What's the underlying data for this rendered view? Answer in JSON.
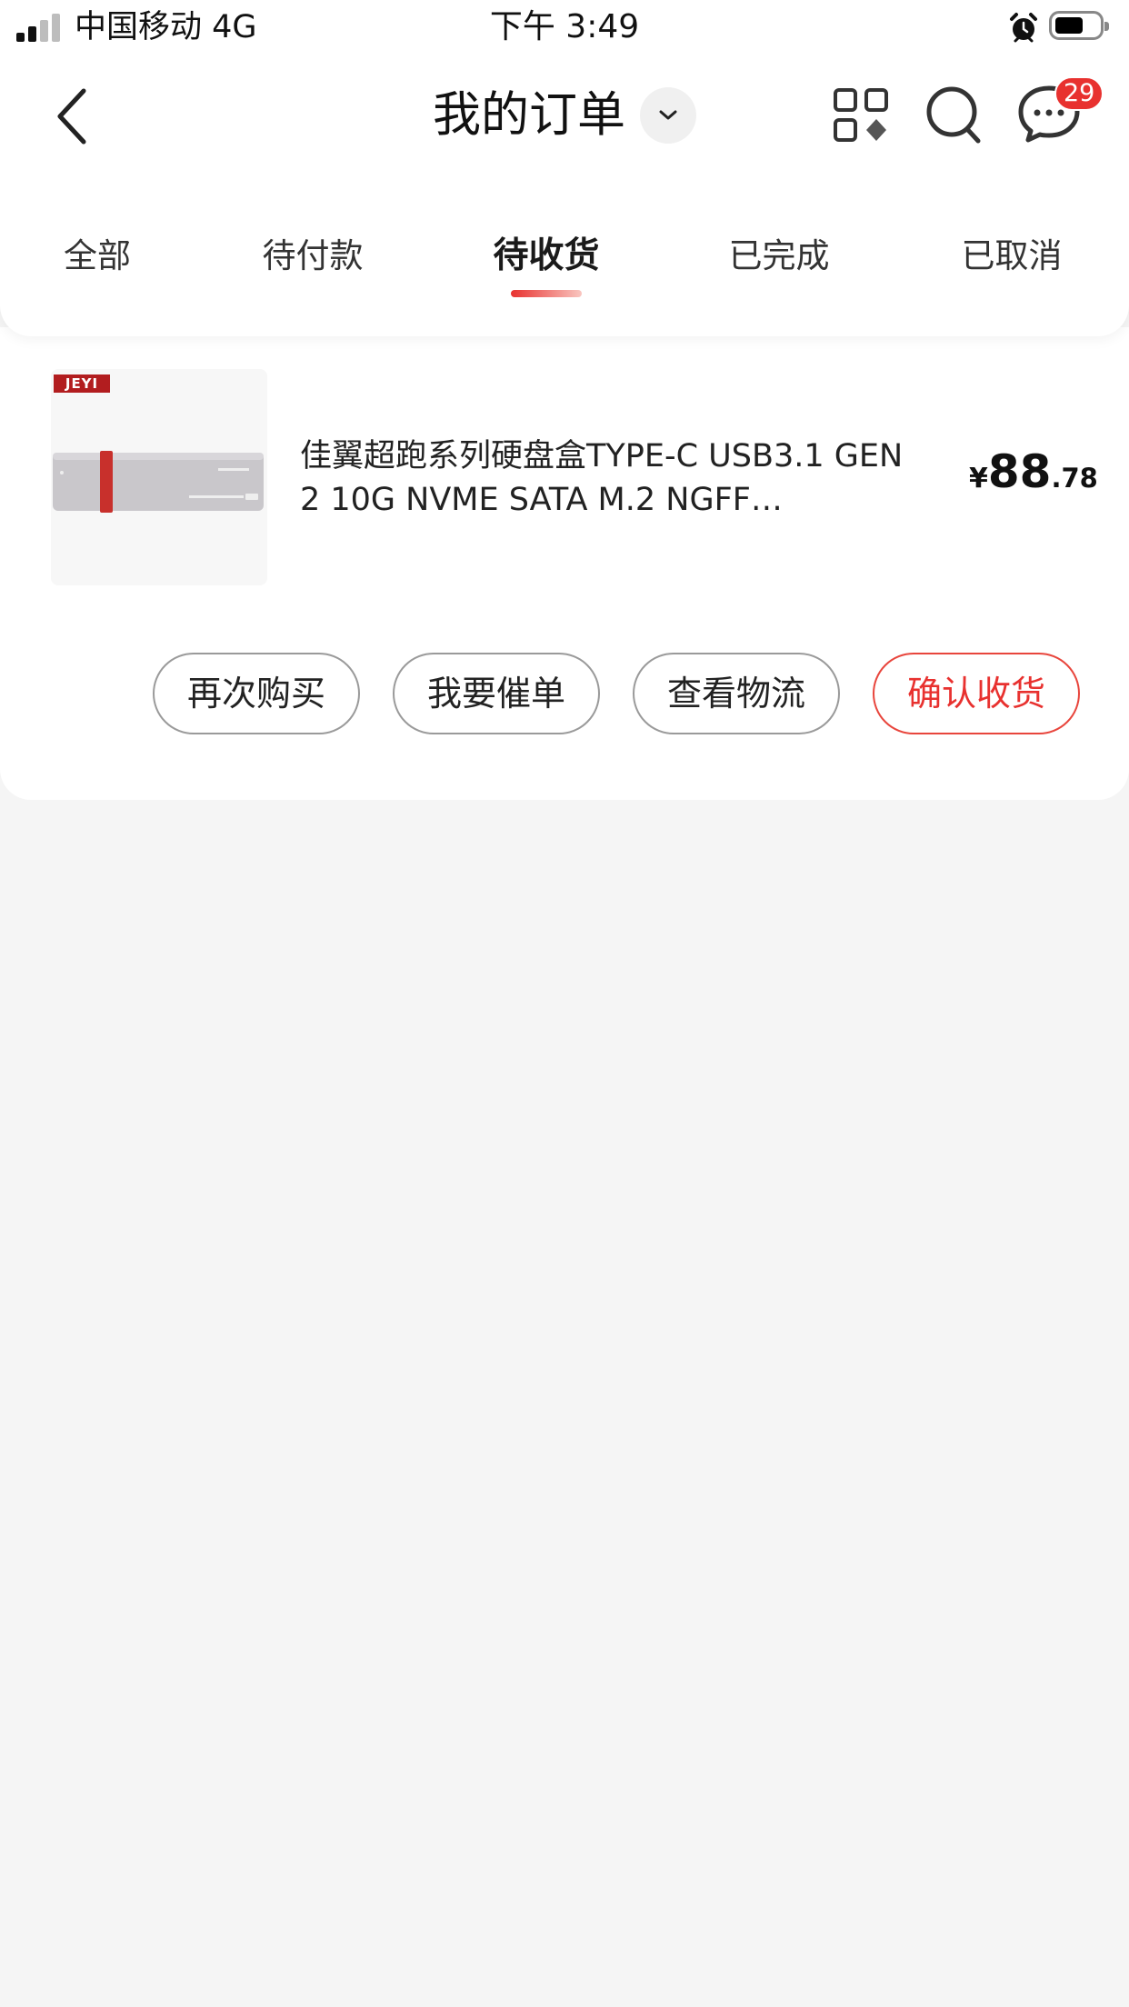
{
  "status_bar": {
    "carrier": "中国移动 4G",
    "time": "下午 3:49",
    "signal_bars_active": 2,
    "signal_bars_total": 4,
    "battery_level": 0.55
  },
  "header": {
    "title": "我的订单",
    "message_badge": "29"
  },
  "tabs": [
    {
      "label": "全部",
      "active": false
    },
    {
      "label": "待付款",
      "active": false
    },
    {
      "label": "待收货",
      "active": true
    },
    {
      "label": "已完成",
      "active": false
    },
    {
      "label": "已取消",
      "active": false
    }
  ],
  "order": {
    "brand_tag": "JEYI",
    "product_name": "佳翼超跑系列硬盘盒TYPE-C USB3.1 GEN2 10G NVME SATA M.2 NGFF…",
    "price_symbol": "¥",
    "price_integer": "88",
    "price_decimal": ".78",
    "actions": [
      {
        "label": "再次购买"
      },
      {
        "label": "我要催单"
      },
      {
        "label": "查看物流"
      },
      {
        "label": "确认收货",
        "primary": true
      }
    ]
  },
  "colors": {
    "accent": "#e8312f",
    "background": "#f5f5f5",
    "card": "#ffffff"
  },
  "icons": [
    "back-chevron-icon",
    "title-dropdown-icon",
    "grid-apps-icon",
    "search-icon",
    "chat-message-icon",
    "alarm-icon",
    "battery-icon",
    "signal-icon"
  ]
}
